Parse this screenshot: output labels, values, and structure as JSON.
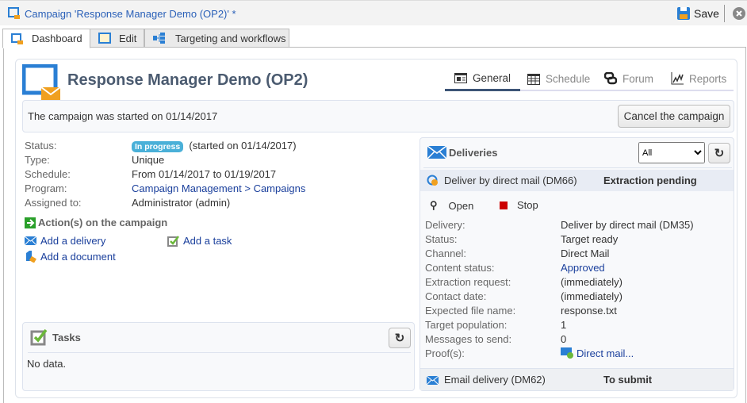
{
  "window": {
    "title": "Campaign 'Response Manager Demo (OP2)' *",
    "save_label": "Save"
  },
  "tabs": [
    {
      "label": "Dashboard",
      "icon": "campaign-icon"
    },
    {
      "label": "Edit",
      "icon": "window-icon"
    },
    {
      "label": "Targeting and workflows",
      "icon": "workflow-icon"
    }
  ],
  "header": {
    "title": "Response Manager Demo (OP2)",
    "tabs": [
      {
        "label": "General",
        "icon": "general-icon",
        "active": true
      },
      {
        "label": "Schedule",
        "icon": "calendar-icon"
      },
      {
        "label": "Forum",
        "icon": "forum-icon"
      },
      {
        "label": "Reports",
        "icon": "chart-icon"
      }
    ]
  },
  "banner": {
    "text": "The campaign was started on 01/14/2017",
    "cancel_label": "Cancel the campaign"
  },
  "info": {
    "status_label": "Status:",
    "status_badge": "In progress",
    "status_extra": "(started on 01/14/2017)",
    "type_label": "Type:",
    "type_value": "Unique",
    "schedule_label": "Schedule:",
    "schedule_value": "From 01/14/2017 to 01/19/2017",
    "program_label": "Program:",
    "program_value": "Campaign Management > Campaigns",
    "assigned_label": "Assigned to:",
    "assigned_value": "Administrator (admin)"
  },
  "actions": {
    "title": "Action(s) on the campaign",
    "add_delivery": "Add a delivery",
    "add_task": "Add a task",
    "add_document": "Add a document"
  },
  "tasks": {
    "title": "Tasks",
    "empty": "No data."
  },
  "deliveries": {
    "title": "Deliveries",
    "filter": "All",
    "selected": {
      "name": "Deliver by direct mail (DM66)",
      "state": "Extraction pending"
    },
    "open_label": "Open",
    "stop_label": "Stop",
    "details": [
      {
        "label": "Delivery:",
        "value": "Deliver by direct mail (DM35)"
      },
      {
        "label": "Status:",
        "value": "Target ready"
      },
      {
        "label": "Channel:",
        "value": "Direct Mail"
      },
      {
        "label": "Content status:",
        "value": "Approved",
        "link": true
      },
      {
        "label": "Extraction request:",
        "value": "(immediately)"
      },
      {
        "label": "Contact date:",
        "value": "(immediately)"
      },
      {
        "label": "Expected file name:",
        "value": "response.txt"
      },
      {
        "label": "Target population:",
        "value": "1"
      },
      {
        "label": "Messages to send:",
        "value": "0"
      },
      {
        "label": "Proof(s):",
        "value": "Direct mail...",
        "link": true
      }
    ],
    "other": {
      "name": "Email delivery (DM62)",
      "state": "To submit"
    }
  },
  "colors": {
    "accent": "#2a60b8",
    "badge": "#4ab0d8",
    "title": "#4b5b70",
    "stop": "#cc0000"
  }
}
